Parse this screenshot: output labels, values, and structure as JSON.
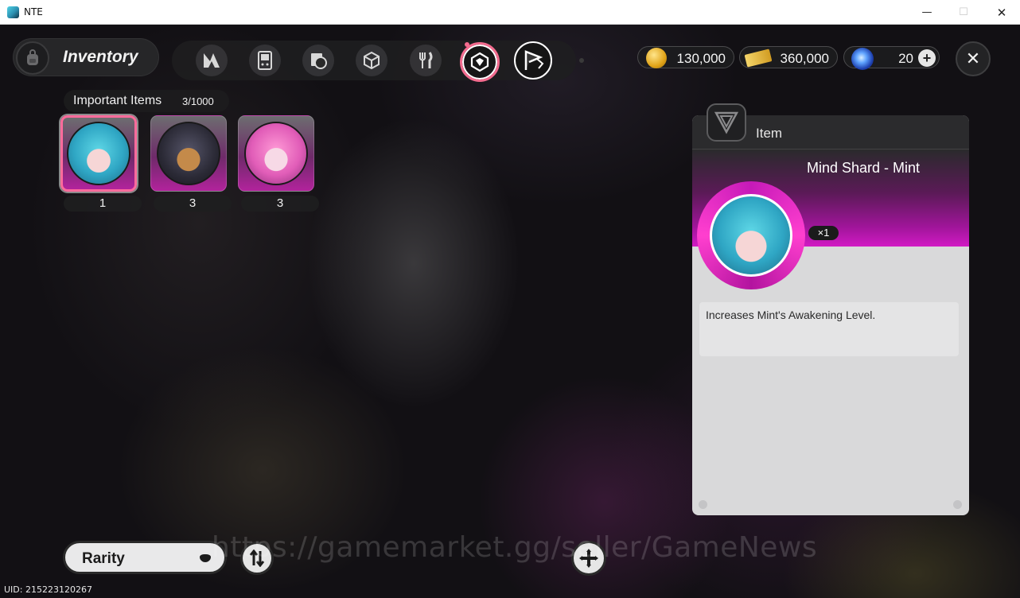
{
  "window": {
    "title": "NTE",
    "minimize_glyph": "—",
    "maximize_glyph": "☐",
    "close_glyph": "✕"
  },
  "header": {
    "title": "Inventory"
  },
  "tabs": [
    {
      "icon": "n-logo-icon",
      "active": false
    },
    {
      "icon": "handheld-console-icon",
      "active": false
    },
    {
      "icon": "disc-box-icon",
      "active": false
    },
    {
      "icon": "cube-icon",
      "active": false
    },
    {
      "icon": "fork-knife-icon",
      "active": false
    },
    {
      "icon": "gem-cube-icon",
      "active": true
    },
    {
      "icon": "flag-icon",
      "active": false
    }
  ],
  "currencies": [
    {
      "icon": "gold-coin-icon",
      "value": "130,000"
    },
    {
      "icon": "ticket-icon",
      "value": "360,000"
    },
    {
      "icon": "blue-orb-icon",
      "value": "20"
    }
  ],
  "category": {
    "name": "Important Items",
    "count": "3/1000"
  },
  "items": [
    {
      "portrait": "mint-portrait",
      "qty": "1",
      "selected": true
    },
    {
      "portrait": "dog-portrait",
      "qty": "3",
      "selected": false
    },
    {
      "portrait": "pink-hair-portrait",
      "qty": "3",
      "selected": false
    }
  ],
  "detail": {
    "header": "Item",
    "name": "Mind Shard - Mint",
    "qty": "×1",
    "description": "Increases Mint's Awakening Level."
  },
  "controls": {
    "sort_label": "Rarity"
  },
  "watermark": "https://gamemarket.gg/seller/GameNews",
  "footer": {
    "uid": "UID: 215223120267"
  },
  "colors": {
    "accent_pink": "#f36b8e",
    "rarity_magenta": "#d21ac4"
  }
}
